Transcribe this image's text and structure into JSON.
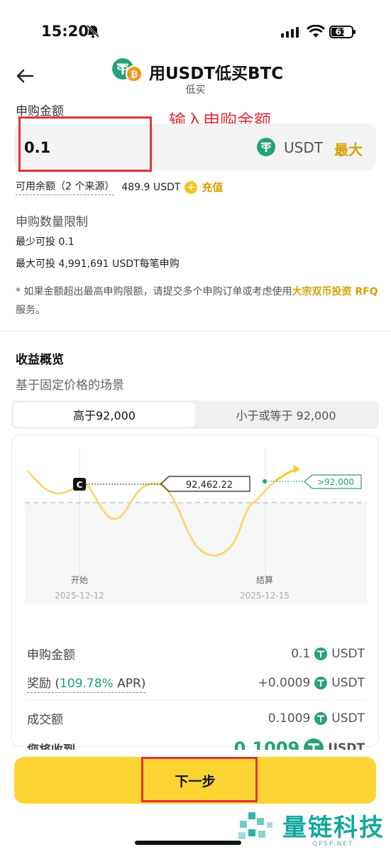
{
  "status_bar": {
    "time": "15:20",
    "battery": "61"
  },
  "header": {
    "title": "用USDT低买BTC",
    "subtitle": "低买"
  },
  "subscribe": {
    "label": "申购金额",
    "annotation": "输入申购金额",
    "amount": "0.1",
    "unit": "USDT",
    "max_label": "最大"
  },
  "available": {
    "label": "可用余额（2 个来源）",
    "amount": "489.9 USDT",
    "recharge_label": "充值"
  },
  "limits": {
    "title": "申购数量限制",
    "min": "最少可投 0.1",
    "max": "最大可投 4,991,691 USDT每笔申购",
    "note_prefix": "* 如果金额超出最高申购限额，请提交多个申购订单或考虑使用",
    "note_link": "大宗双币投资 RFQ",
    "note_suffix": " 服务。"
  },
  "profit": {
    "title": "收益概览",
    "subtitle": "基于固定价格的场景",
    "tabs": [
      {
        "label": "高于92,000",
        "active": true
      },
      {
        "label": "小于或等于 92,000",
        "active": false
      }
    ]
  },
  "chart_data": {
    "type": "line",
    "marker": "C",
    "current_price_label": "92,462.22",
    "target_label": ">92,000",
    "start": {
      "label": "开始",
      "date": "2025-12-12"
    },
    "end": {
      "label": "结算",
      "date": "2025-12-15"
    }
  },
  "details": {
    "amount_label": "申购金额",
    "amount_value": "0.1",
    "amount_unit": "USDT",
    "reward_prefix": "奖励 (",
    "reward_apr": "109.78%",
    "reward_suffix": " APR)",
    "reward_value": "+0.0009",
    "reward_unit": "USDT",
    "deal_label": "成交额",
    "deal_value": "0.1009",
    "deal_unit": "USDT",
    "receive_label": "您将收到",
    "receive_value": "0.1009",
    "receive_unit": "USDT"
  },
  "footer": {
    "next_label": "下一步"
  },
  "watermark": {
    "text": "量链科技",
    "sub": "QFSP.NET"
  },
  "colors": {
    "accent": "#fcd535",
    "link": "#d6a100",
    "green": "#20a36b",
    "annotation": "#e0343a",
    "usdt": "#26a17b"
  }
}
